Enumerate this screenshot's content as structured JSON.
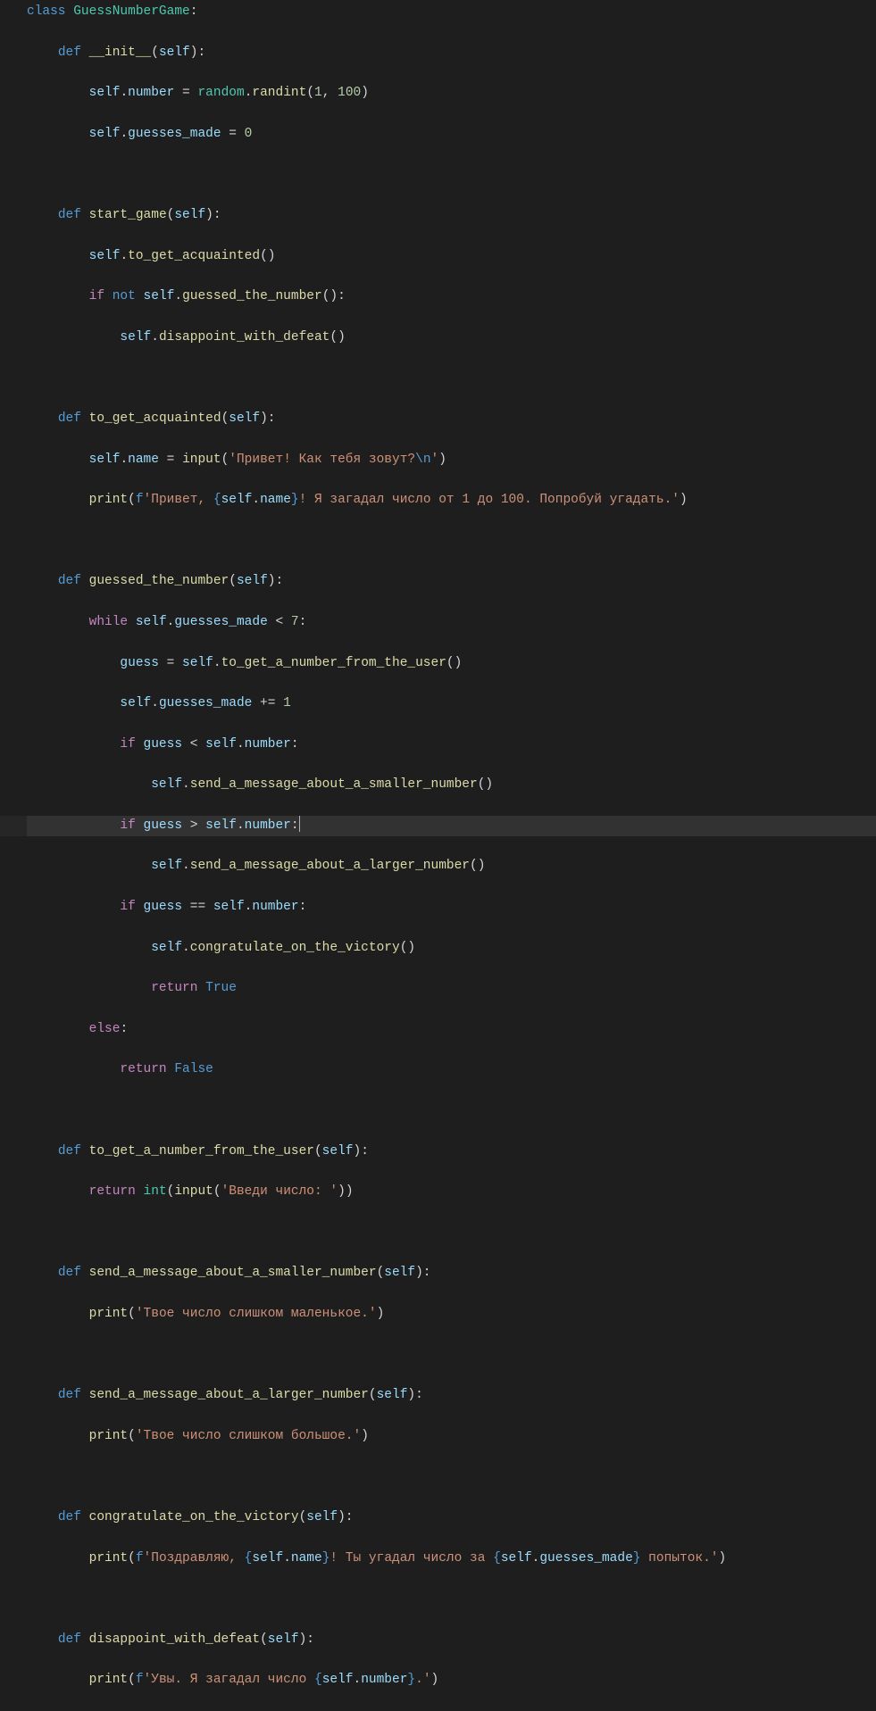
{
  "code": {
    "class_keyword": "class",
    "class_name": "GuessNumberGame",
    "def_keyword": "def",
    "self": "self",
    "not": "not",
    "if": "if",
    "while": "while",
    "else": "else",
    "return": "return",
    "true": "True",
    "false": "False",
    "methods": {
      "init": "__init__",
      "start_game": "start_game",
      "to_get_acquainted": "to_get_acquainted",
      "guessed_the_number": "guessed_the_number",
      "to_get_a_number_from_the_user": "to_get_a_number_from_the_user",
      "send_a_message_about_a_smaller_number": "send_a_message_about_a_smaller_number",
      "send_a_message_about_a_larger_number": "send_a_message_about_a_larger_number",
      "congratulate_on_the_victory": "congratulate_on_the_victory",
      "disappoint_with_defeat": "disappoint_with_defeat"
    },
    "builtins": {
      "random": "random",
      "randint": "randint",
      "input": "input",
      "print": "print",
      "int": "int"
    },
    "attrs": {
      "number": "number",
      "guesses_made": "guesses_made",
      "name": "name"
    },
    "vars": {
      "guess": "guess"
    },
    "nums": {
      "n1": "1",
      "n100": "100",
      "n0": "0",
      "n7": "7"
    },
    "strings": {
      "greet_prompt": "'Привет! Как тебя зовут?",
      "newline": "\\n",
      "close_quote": "'",
      "greet1_pre": "'Привет, ",
      "greet1_post": "! Я загадал число от 1 до 100. Попробуй угадать.'",
      "enter_number": "'Введи число: '",
      "too_small": "'Твое число слишком маленькое.'",
      "too_big": "'Твое число слишком большое.'",
      "congrats_pre": "'Поздравляю, ",
      "congrats_mid": "! Ты угадал число за ",
      "congrats_post": " попыток.'",
      "defeat_pre": "'Увы. Я загадал число ",
      "defeat_post": ".'",
      "f_prefix": "f"
    },
    "ops": {
      "assign": " = ",
      "plus_assign": " += ",
      "lt": " < ",
      "gt": " > ",
      "eq": " == ",
      "colon": ":",
      "dot": ".",
      "comma": ", ",
      "lparen": "(",
      "rparen": ")",
      "lbrace": "{",
      "rbrace": "}"
    }
  }
}
